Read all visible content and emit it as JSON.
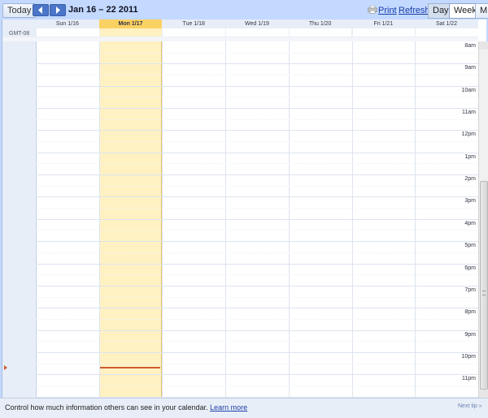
{
  "toolbar": {
    "today_label": "Today",
    "prev_icon": "chevron-left-icon",
    "next_icon": "chevron-right-icon",
    "date_range": "Jan 16 – 22 2011",
    "print_label": "Print",
    "print_icon": "printer-icon",
    "refresh_label": "Refresh",
    "view_day": "Day",
    "view_week": "Week",
    "view_month": "M",
    "selected_view": "Week"
  },
  "timezone": "GMT-08",
  "days": [
    {
      "label": "Sun 1/16"
    },
    {
      "label": "Mon 1/17",
      "today": true
    },
    {
      "label": "Tue 1/18"
    },
    {
      "label": "Wed 1/19"
    },
    {
      "label": "Thu 1/20"
    },
    {
      "label": "Fri 1/21"
    },
    {
      "label": "Sat 1/22"
    }
  ],
  "hours": [
    "8am",
    "9am",
    "10am",
    "11am",
    "12pm",
    "1pm",
    "2pm",
    "3pm",
    "4pm",
    "5pm",
    "6pm",
    "7pm",
    "8pm",
    "9pm",
    "10pm",
    "11pm"
  ],
  "footer": {
    "message": "Control how much information others can see in your calendar.",
    "learn_more": "Learn more",
    "next_tip": "Next tip »"
  },
  "colors": {
    "chrome": "#c3d9ff",
    "today_header": "#fad163",
    "today_column": "#fff1c2",
    "now_line": "#d05a33",
    "link": "#1a3ea8"
  }
}
